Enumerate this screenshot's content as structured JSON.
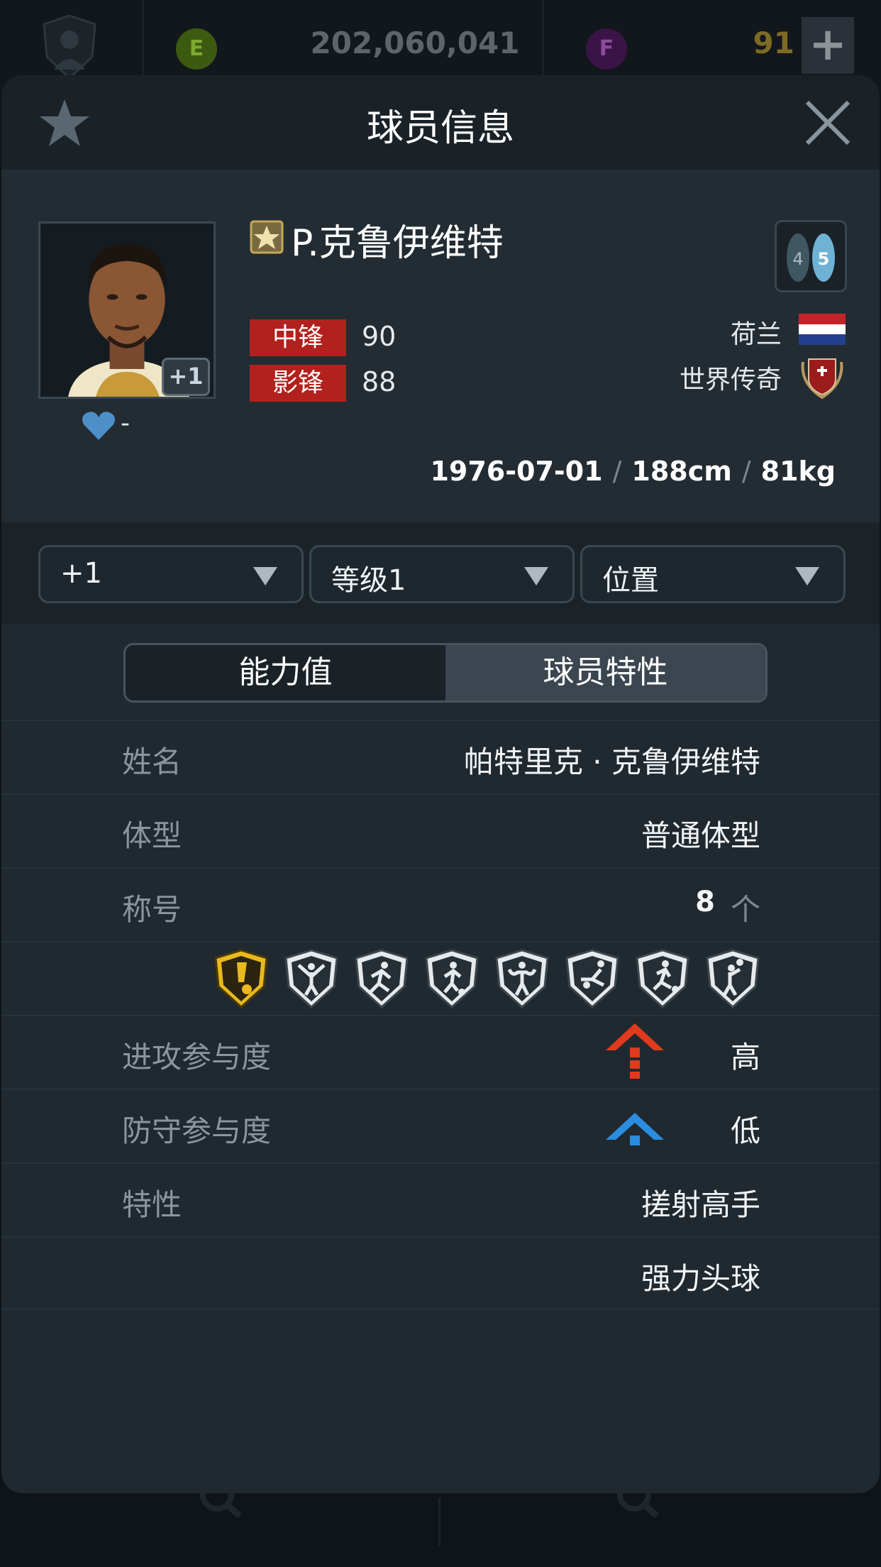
{
  "topbar": {
    "ep_label": "E",
    "ep_value": "202,060,041",
    "fp_label": "F",
    "fp_value": "91",
    "add_label": "+"
  },
  "modal": {
    "title": "球员信息",
    "player": {
      "name": "P.克鲁伊维特",
      "enhance_badge": "+1",
      "likes": "-",
      "weak_foot_left": "4",
      "weak_foot_right": "5",
      "positions": [
        {
          "pos": "中锋",
          "rating": "90"
        },
        {
          "pos": "影锋",
          "rating": "88"
        }
      ],
      "nation": "荷兰",
      "league": "世界传奇",
      "birthdate": "1976-07-01",
      "height": "188cm",
      "weight": "81kg"
    },
    "selectors": {
      "enhance": "+1",
      "level": "等级1",
      "position": "位置"
    },
    "tabs": {
      "stats": "能力值",
      "traits": "球员特性"
    },
    "traits": {
      "full_name_label": "姓名",
      "full_name": "帕特里克 · 克鲁伊维特",
      "body_label": "体型",
      "body_type": "普通体型",
      "titles_label": "称号",
      "titles_count": "8",
      "titles_unit": "个",
      "attack_label": "进攻参与度",
      "attack_value": "高",
      "defense_label": "防守参与度",
      "defense_value": "低",
      "skills_label": "特性",
      "skills": [
        "搓射高手",
        "强力头球"
      ]
    }
  },
  "colors": {
    "position_tag": "#b2211d",
    "attack_high": "#e23a1c",
    "defense_low": "#2a8de0",
    "gold_badge": "#e9b91d"
  }
}
